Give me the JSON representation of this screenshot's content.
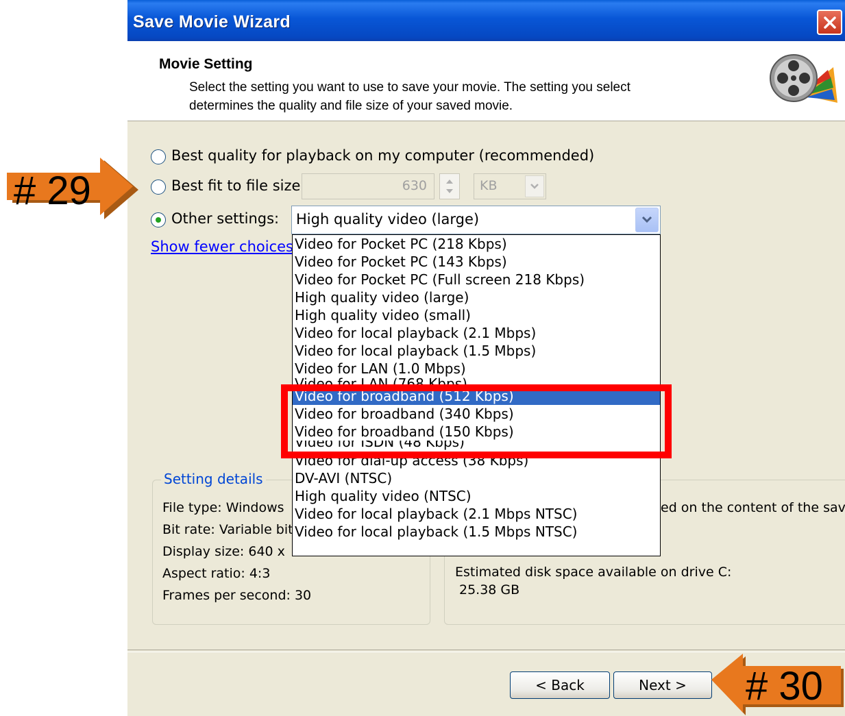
{
  "window": {
    "title": "Save Movie Wizard"
  },
  "header": {
    "title": "Movie Setting",
    "subtitle_line1": "Select the setting you want to use to save your movie. The setting you select",
    "subtitle_line2": "determines the quality and file size of your saved movie."
  },
  "options": {
    "best_quality": "Best quality for playback on my computer (recommended)",
    "best_fit": "Best fit to file size:",
    "file_size_value": "630",
    "file_size_unit": "KB",
    "other_settings": "Other settings:",
    "selected_setting": "High quality video (large)",
    "show_fewer": "Show fewer choices..."
  },
  "dropdown": {
    "items": [
      "Video for Pocket PC (218 Kbps)",
      "Video for Pocket PC (143 Kbps)",
      "Video for Pocket PC (Full screen 218 Kbps)",
      "High quality video (large)",
      "High quality video (small)",
      "Video for local playback (2.1 Mbps)",
      "Video for local playback (1.5 Mbps)",
      "Video for LAN (1.0 Mbps)",
      "Video for LAN (768 Kbps)",
      "Video for broadband (512 Kbps)",
      "Video for broadband (340 Kbps)",
      "Video for broadband (150 Kbps)",
      "Video for ISDN (48 Kbps)",
      "Video for dial-up access (38 Kbps)",
      "DV-AVI (NTSC)",
      "High quality video (NTSC)",
      "Video for local playback (2.1 Mbps NTSC)",
      "Video for local playback (1.5 Mbps NTSC)"
    ],
    "highlighted": "Video for broadband (512 Kbps)"
  },
  "setting_details": {
    "legend": "Setting details",
    "file_type": "File type: Windows",
    "bit_rate": "Bit rate: Variable bit",
    "display_size": "Display size: 640 x",
    "aspect_ratio": "Aspect ratio: 4:3",
    "fps": "Frames per second: 30"
  },
  "movie_file_size": {
    "note": "ed on the content of the sav",
    "disk_label": "Estimated disk space available on drive C:",
    "disk_value": "25.38 GB"
  },
  "buttons": {
    "back": "< Back",
    "next": "Next >"
  },
  "annotations": {
    "step_a": "# 29",
    "step_b": "# 30",
    "arrow_color": "#e8781e",
    "box_color": "#ff0000"
  }
}
